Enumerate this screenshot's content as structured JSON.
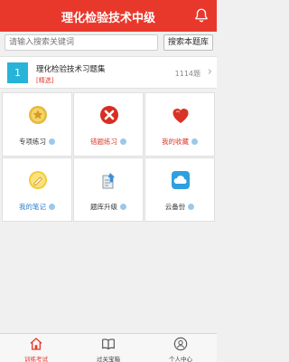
{
  "header": {
    "title": "理化检验技术中级",
    "bell_icon": "bell-icon"
  },
  "search": {
    "placeholder": "请输入搜索关键词",
    "button": "搜索本题库"
  },
  "bank": {
    "index": "1",
    "name": "理化检验技术习题集",
    "tag": "[精选]",
    "count": "1114题",
    "chevron": "›"
  },
  "grid": [
    {
      "label": "专项练习",
      "icon": "star-medal-icon",
      "color": "normal"
    },
    {
      "label": "错题练习",
      "icon": "wrong-x-icon",
      "color": "red"
    },
    {
      "label": "我的收藏",
      "icon": "heart-icon",
      "color": "red"
    },
    {
      "label": "我的笔记",
      "icon": "note-icon",
      "color": "blue"
    },
    {
      "label": "题库升级",
      "icon": "upgrade-icon",
      "color": "normal"
    },
    {
      "label": "云备份",
      "icon": "cloud-backup-icon",
      "color": "normal"
    }
  ],
  "tabs": [
    {
      "label": "训练考试",
      "icon": "home-icon",
      "active": true
    },
    {
      "label": "过关宝箱",
      "icon": "book-icon",
      "active": false
    },
    {
      "label": "个人中心",
      "icon": "user-icon",
      "active": false
    }
  ],
  "colors": {
    "header": "#e8382c",
    "accent_blue": "#28b3d8"
  }
}
